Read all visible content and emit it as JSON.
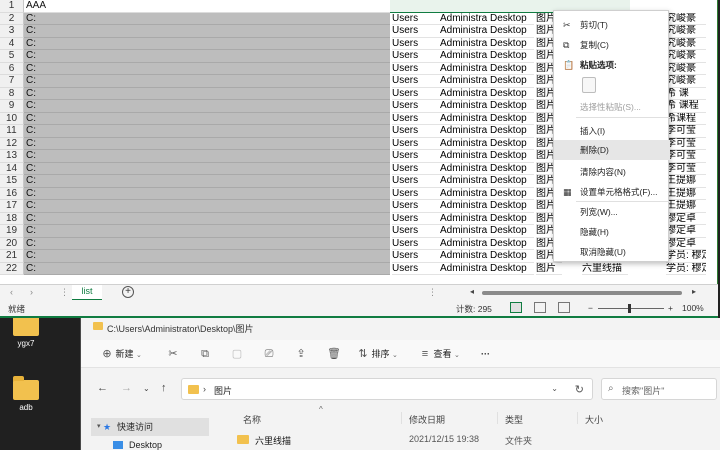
{
  "desktop": {
    "icons": [
      {
        "label": "ygx7"
      },
      {
        "label": "adb"
      }
    ]
  },
  "excel": {
    "cell_a1": "AAA",
    "row_numbers": [
      "1",
      "2",
      "3",
      "4",
      "5",
      "6",
      "7",
      "8",
      "9",
      "10",
      "11",
      "12",
      "13",
      "14",
      "15",
      "16",
      "17",
      "18",
      "19",
      "20",
      "21",
      "22"
    ],
    "col_a_text": "C:",
    "col_b_text": "Users",
    "col_c_text": "Administra Desktop",
    "col_d_text": "图片",
    "col_e_values": [
      "",
      "究峻豪",
      "究峻豪",
      "究峻豪",
      "究峻豪",
      "究峻豪",
      "究峻豪",
      "希 课",
      "希 课程",
      "希课程",
      "李可莹",
      "李可莹",
      "李可莹",
      "李可莹",
      "王提娜",
      "王提娜",
      "王提娜",
      "穆定卓",
      "穆定卓",
      "穆定卓",
      "学员: 穆定卓",
      "学员: 穆定卓"
    ],
    "row22_d_extra": "六里线描",
    "sheet_tab": "list",
    "status_ready": "就绪",
    "status_count": "计数: 295",
    "zoom": "100%"
  },
  "context_menu": {
    "items": [
      {
        "label": "剪切(T)",
        "icon": "scissors-icon",
        "glyph": "✂"
      },
      {
        "label": "复制(C)",
        "icon": "copy-icon",
        "glyph": "⧉"
      },
      {
        "label": "粘贴选项:",
        "icon": "paste-icon",
        "glyph": "📋"
      },
      {
        "label": "选择性粘贴(S)...",
        "icon": "",
        "glyph": ""
      },
      {
        "label": "插入(I)",
        "icon": "",
        "glyph": ""
      },
      {
        "label": "删除(D)",
        "icon": "",
        "glyph": ""
      },
      {
        "label": "清除内容(N)",
        "icon": "",
        "glyph": ""
      },
      {
        "label": "设置单元格格式(F)...",
        "icon": "format-cells-icon",
        "glyph": "▦"
      },
      {
        "label": "列宽(W)...",
        "icon": "",
        "glyph": ""
      },
      {
        "label": "隐藏(H)",
        "icon": "",
        "glyph": ""
      },
      {
        "label": "取消隐藏(U)",
        "icon": "",
        "glyph": ""
      }
    ]
  },
  "explorer": {
    "title": "C:\\Users\\Administrator\\Desktop\\图片",
    "toolbar": {
      "new_label": "新建",
      "sort_label": "排序",
      "view_label": "查看",
      "more_label": "···"
    },
    "address": "图片",
    "search_placeholder": "搜索\"图片\"",
    "nav_pane": {
      "quick_access": "快速访问",
      "desktop": "Desktop"
    },
    "columns": {
      "name": "名称",
      "modified": "修改日期",
      "type": "类型",
      "size": "大小"
    },
    "files": [
      {
        "name": "六里线描",
        "modified": "2021/12/15 19:38",
        "type": "文件夹"
      }
    ]
  }
}
